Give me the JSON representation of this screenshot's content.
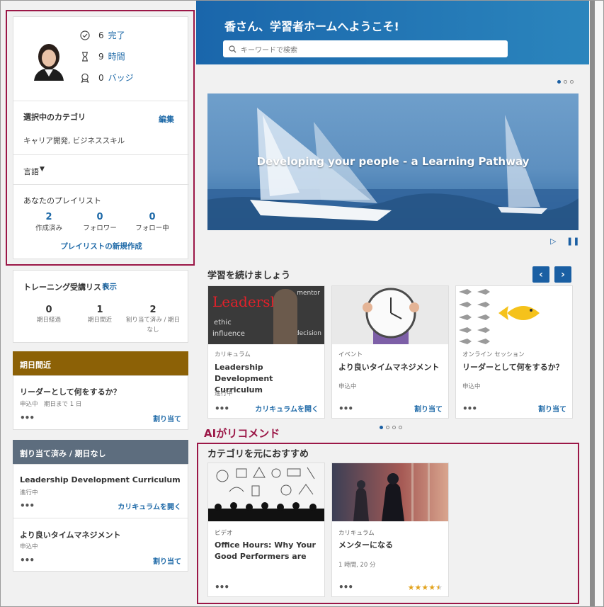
{
  "profile": {
    "stats": [
      {
        "num": "6",
        "label": "完了",
        "icon": "check-circle-icon"
      },
      {
        "num": "9",
        "label": "時間",
        "icon": "hourglass-icon"
      },
      {
        "num": "0",
        "label": "バッジ",
        "icon": "badge-icon"
      }
    ],
    "category_title": "選択中のカテゴリ",
    "edit": "編集",
    "categories": "キャリア開発, ビジネススキル",
    "language": "言語",
    "playlist_title": "あなたのプレイリスト",
    "playlist_stats": [
      {
        "num": "2",
        "label": "作成済み"
      },
      {
        "num": "0",
        "label": "フォロワー"
      },
      {
        "num": "0",
        "label": "フォロー中"
      }
    ],
    "new_playlist": "プレイリストの新規作成"
  },
  "training": {
    "title": "トレーニング受講リスト",
    "show": "表示",
    "stats": [
      {
        "num": "0",
        "label": "期日経過"
      },
      {
        "num": "1",
        "label": "期日間近"
      },
      {
        "num": "2",
        "label": "割り当て済み / 期日なし"
      }
    ]
  },
  "due_soon": {
    "header": "期日間近",
    "item_title": "リーダーとして何をするか？",
    "item_status": "申込中　期日まで 1 日",
    "action": "割り当て"
  },
  "assigned": {
    "header": "割り当て済み / 期日なし",
    "items": [
      {
        "title": "Leadership Development Curriculum",
        "status": "進行中",
        "action": "カリキュラムを開く"
      },
      {
        "title": "より良いタイムマネジメント",
        "status": "申込中",
        "action": "割り当て"
      }
    ]
  },
  "hero": {
    "title": "香さん、学習者ホームへようこそ!",
    "search_placeholder": "キーワードで検索"
  },
  "banner": {
    "text": "Developing your people - a Learning Pathway"
  },
  "continue": {
    "title": "学習を続けましょう",
    "cards": [
      {
        "thumb_text": "Leadership",
        "type": "カリキュラム",
        "title": "Leadership Development Curriculum",
        "status": "進行中",
        "action": "カリキュラムを開く"
      },
      {
        "type": "イベント",
        "title": "より良いタイムマネジメント",
        "status": "申込中",
        "action": "割り当て"
      },
      {
        "type": "オンライン セッション",
        "title": "リーダーとして何をするか？",
        "status": "申込中",
        "action": "割り当て"
      }
    ]
  },
  "ai": {
    "label": "AIがリコメンド",
    "title": "カテゴリを元におすすめ",
    "cards": [
      {
        "type": "ビデオ",
        "title": "Office Hours: Why Your Good Performers are Be"
      },
      {
        "type": "カリキュラム",
        "title": "メンターになる",
        "meta": "1 時間, 20 分",
        "rating": 4.5
      }
    ]
  },
  "more_glyph": "•••",
  "colors": {
    "accent": "#1f6aa8",
    "highlight": "#9b1747",
    "due": "#8c6106",
    "assigned": "#5d6d7e"
  }
}
